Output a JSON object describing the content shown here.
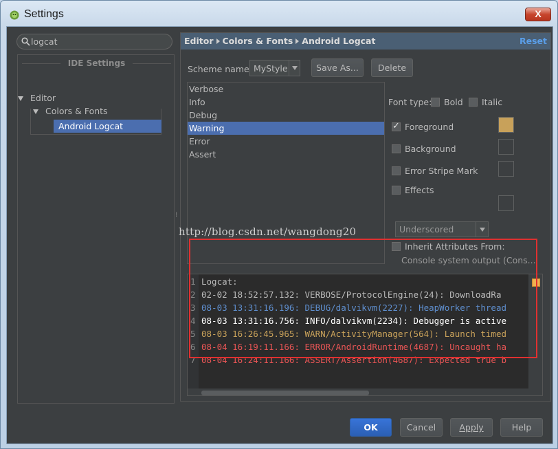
{
  "window": {
    "title": "Settings",
    "close_label": "X"
  },
  "search": {
    "value": "logcat"
  },
  "tree": {
    "section": "IDE Settings",
    "items": [
      {
        "label": "Editor"
      },
      {
        "label": "Colors & Fonts"
      },
      {
        "label": "Android Logcat"
      }
    ]
  },
  "header": {
    "crumbs": [
      "Editor",
      "Colors & Fonts",
      "Android Logcat"
    ],
    "reset_label": "Reset"
  },
  "scheme": {
    "label": "Scheme name:",
    "value": "MyStyle",
    "save_as_label": "Save As...",
    "delete_label": "Delete"
  },
  "color_list": {
    "items": [
      "Verbose",
      "Info",
      "Debug",
      "Warning",
      "Error",
      "Assert"
    ],
    "selected": "Warning"
  },
  "options": {
    "font_type_label": "Font type:",
    "bold_label": "Bold",
    "italic_label": "Italic",
    "foreground_label": "Foreground",
    "foreground_checked": true,
    "foreground_color": "#c8a15a",
    "background_label": "Background",
    "error_stripe_label": "Error Stripe Mark",
    "effects_label": "Effects",
    "effects_value": "Underscored",
    "inherit_label": "Inherit Attributes From:",
    "inherit_value": "Console system output (Cons..."
  },
  "watermark": "http://blog.csdn.net/wangdong20",
  "preview": {
    "lines": [
      {
        "n": "1",
        "text": "Logcat:",
        "color": "#bbbbbb"
      },
      {
        "n": "2",
        "text": "02-02 18:52:57.132: VERBOSE/ProtocolEngine(24): DownloadRa",
        "color": "#bbbbbb"
      },
      {
        "n": "3",
        "text": "08-03 13:31:16.196: DEBUG/dalvikvm(2227): HeapWorker thread",
        "color": "#5f8fcf"
      },
      {
        "n": "4",
        "text": "08-03 13:31:16.756: INFO/dalvikvm(2234): Debugger is active",
        "color": "#ffffff"
      },
      {
        "n": "5",
        "text": "08-03 16:26:45.965: WARN/ActivityManager(564): Launch timed",
        "color": "#c8a15a"
      },
      {
        "n": "6",
        "text": "08-04 16:19:11.166: ERROR/AndroidRuntime(4687): Uncaught ha",
        "color": "#e85555"
      },
      {
        "n": "7",
        "text": "08-04 16:24:11.166: ASSERT/Assertion(4687): Expected true b",
        "color": "#e85555"
      }
    ]
  },
  "buttons": {
    "ok": "OK",
    "cancel": "Cancel",
    "apply": "Apply",
    "help": "Help"
  }
}
